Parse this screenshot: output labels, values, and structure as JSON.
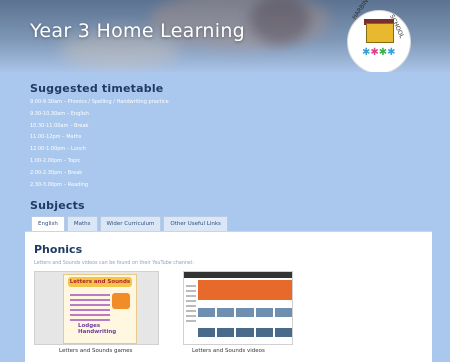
{
  "banner": {
    "title": "Year 3 Home Learning",
    "logo_text_left": "HARBINGER",
    "logo_text_right": "SCHOOL"
  },
  "timetable": {
    "heading": "Suggested timetable",
    "items": [
      "9.00-9.30am – Phonics / Spelling / Handwriting practice",
      "9.30-10.30am – English",
      "10.30-11.00am – Break",
      "11.00-12pm – Maths",
      "12.00-1.00pm – Lunch",
      "1.00-2.00pm – Topic",
      "2.00-2.30pm – Break",
      "2.30-3.00pm – Reading"
    ]
  },
  "subjects": {
    "heading": "Subjects",
    "tabs": [
      {
        "label": "English",
        "active": true
      },
      {
        "label": "Maths",
        "active": false
      },
      {
        "label": "Wider Curriculum",
        "active": false
      },
      {
        "label": "Other Useful Links",
        "active": false
      }
    ]
  },
  "panel": {
    "title": "Phonics",
    "description": "Letters and Sounds videos can be found on their YouTube channel:",
    "cards": [
      {
        "caption": "Letters and Sounds games",
        "thumb_heading": "Letters and Sounds",
        "thumb_footer": "Lodges Handwriting"
      },
      {
        "caption": "Letters and Sounds videos"
      }
    ]
  },
  "colors": {
    "page_bg": "#aac8ee",
    "heading": "#1f3b63",
    "tab_bg": "#dbe7f6"
  }
}
